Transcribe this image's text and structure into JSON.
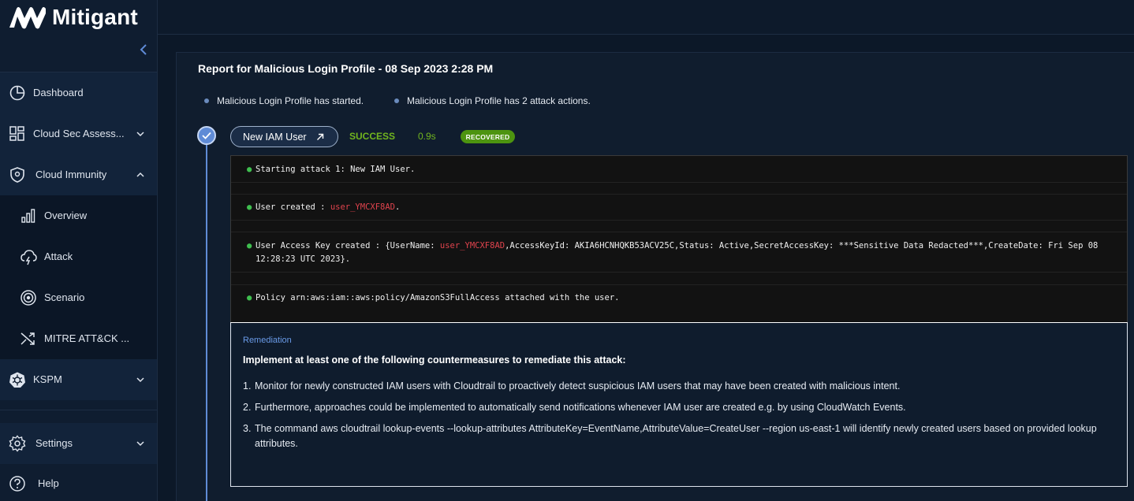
{
  "app": {
    "logo_text": "Mitigant"
  },
  "sidebar": {
    "items": [
      {
        "label": "Dashboard",
        "icon": "pie-chart-icon"
      },
      {
        "label": "Cloud Sec Assess...",
        "icon": "grid-icon"
      },
      {
        "label": "Cloud Immunity",
        "icon": "shield-icon"
      },
      {
        "label": "KSPM",
        "icon": "kubernetes-icon"
      },
      {
        "label": "Settings",
        "icon": "gear-icon"
      },
      {
        "label": "Help",
        "icon": "help-icon"
      }
    ],
    "cloud_immunity_sub": [
      {
        "label": "Overview",
        "icon": "bar-chart-icon"
      },
      {
        "label": "Attack",
        "icon": "cloud-bolt-icon"
      },
      {
        "label": "Scenario",
        "icon": "target-icon"
      },
      {
        "label": "MITRE ATT&CK ...",
        "icon": "shuffle-icon"
      }
    ]
  },
  "report": {
    "title": "Report for Malicious Login Profile - 08 Sep 2023 2:28 PM",
    "bullets": [
      "Malicious Login Profile has started.",
      "Malicious Login Profile has 2 attack actions."
    ]
  },
  "attack": {
    "name": "New IAM User",
    "status": "SUCCESS",
    "duration": "0.9s",
    "badge": "RECOVERED"
  },
  "log": {
    "line1": "Starting attack 1: New IAM User.",
    "line2_prefix": "User created : ",
    "line2_user": "user_YMCXF8AD",
    "line2_suffix": ".",
    "line3_prefix": "User Access Key created : {UserName: ",
    "line3_user": "user_YMCXF8AD",
    "line3_rest": ",AccessKeyId: AKIA6HCNHQKB53ACV25C,Status: Active,SecretAccessKey: ***Sensitive Data Redacted***,CreateDate: Fri Sep 08 12:28:23 UTC 2023}.",
    "line4": "Policy arn:aws:iam::aws:policy/AmazonS3FullAccess attached with the user."
  },
  "remediation": {
    "label": "Remediation",
    "heading": "Implement at least one of the following countermeasures to remediate this attack:",
    "items": [
      {
        "num": "1.",
        "text": "Monitor for newly constructed IAM users with Cloudtrail to proactively detect suspicious IAM users that may have been created with malicious intent."
      },
      {
        "num": "2.",
        "text": "Furthermore, approaches could be implemented to automatically send notifications whenever IAM user are created e.g. by using CloudWatch Events."
      },
      {
        "num": "3.",
        "text": "The command aws cloudtrail lookup-events --lookup-attributes AttributeKey=EventName,AttributeValue=CreateUser --region us-east-1 will identify newly created users based on provided lookup attributes."
      }
    ]
  },
  "colors": {
    "accent": "#5f8bd6",
    "success": "#71b51e",
    "badge": "#4d9410",
    "highlight_red": "#e0434d"
  }
}
